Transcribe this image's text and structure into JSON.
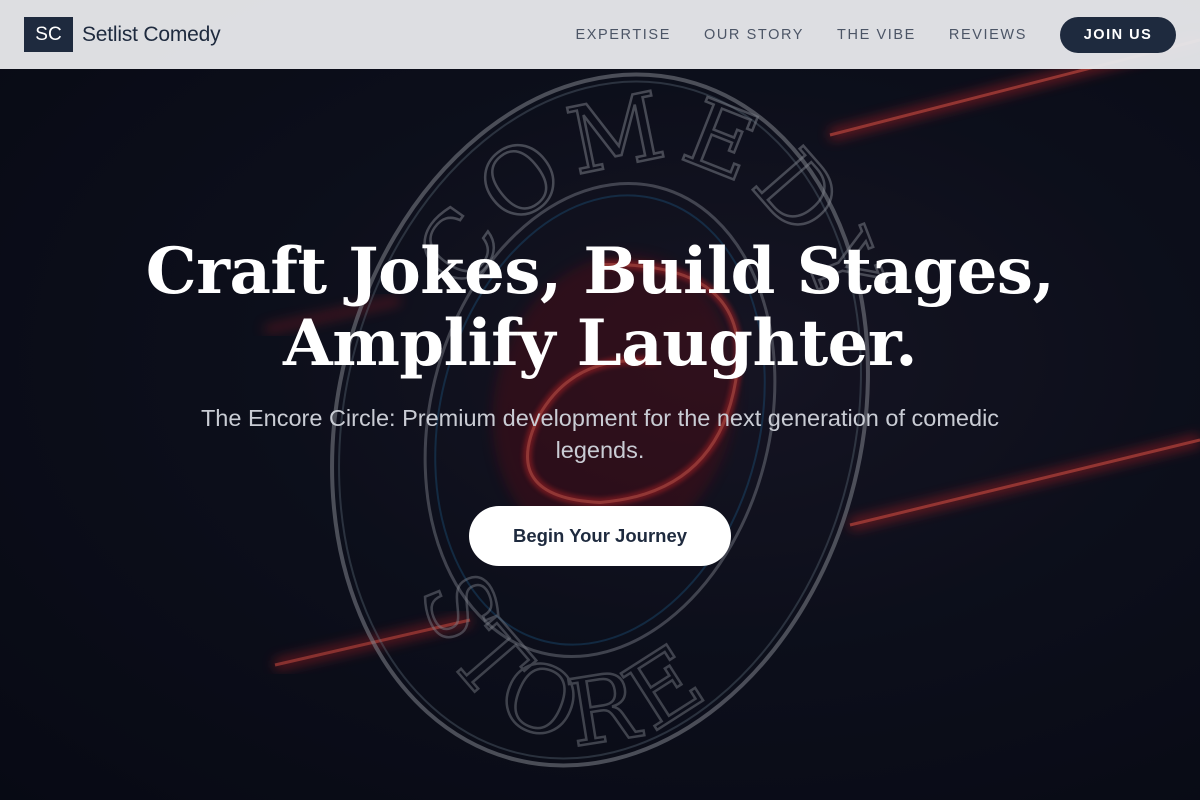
{
  "brand": {
    "mark": "SC",
    "name": "Setlist Comedy"
  },
  "nav": {
    "items": [
      {
        "label": "EXPERTISE"
      },
      {
        "label": "OUR STORY"
      },
      {
        "label": "THE VIBE"
      },
      {
        "label": "REVIEWS"
      }
    ],
    "join_label": "JOIN US"
  },
  "hero": {
    "title_line1": "Craft Jokes, Build Stages,",
    "title_line2": "Amplify Laughter.",
    "subtitle": "The Encore Circle: Premium development for the next generation of comedic legends.",
    "cta_label": "Begin Your Journey",
    "background_sign": {
      "top_text": "COMEDY",
      "bottom_text": "STORE"
    }
  },
  "colors": {
    "navy": "#1e2a3e",
    "header_bg": "#e6e7ea",
    "hero_bg": "#0b0e1a",
    "neon_red": "#d8282a",
    "neon_white": "#c8ccd4"
  }
}
